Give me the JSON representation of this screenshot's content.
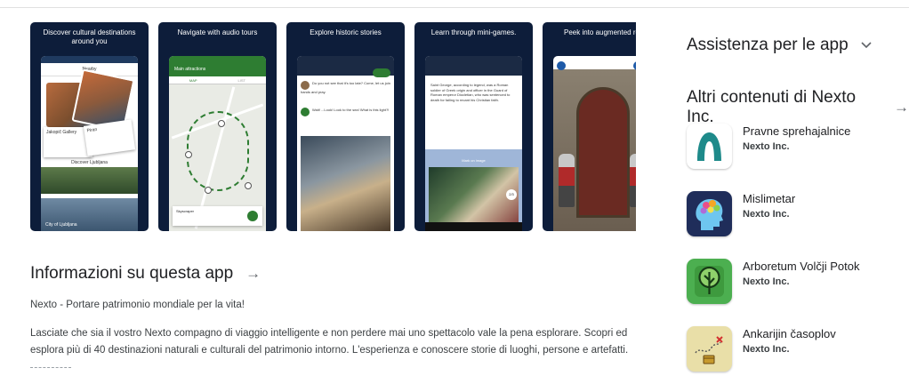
{
  "screenshots": [
    {
      "caption": "Discover cultural destinations around you",
      "app_bar": "Nearby",
      "card_a_title": "Jakopič Gallery",
      "card_b_title": "Piran",
      "sub_label": "Discover Ljubljana",
      "bottom_label": "City of Ljubljana"
    },
    {
      "caption": "Navigate with audio tours",
      "app_bar": "Main attractions",
      "map_tab": "MAP",
      "list_tab": "LIST",
      "player_label": "Skyscraper"
    },
    {
      "caption": "Explore historic stories",
      "chat_1": "Do you not see that it's too late? Come, let us join hands and pray.",
      "chat_2": "Wait! ...Look! Look to the sea! What is this light?!"
    },
    {
      "caption": "Learn through mini-games.",
      "quiz_text": "Saint George, according to legend, was a Roman soldier of Greek origin and officer in the Guard of Roman emperor Diocletian, who was sentenced to death for failing to recant his Christian faith.",
      "hint": "Mark on image",
      "counter": "2/3"
    },
    {
      "caption": "Peek into augmented reality"
    }
  ],
  "about": {
    "title": "Informazioni su questa app",
    "tagline": "Nexto - Portare patrimonio mondiale per la vita!",
    "description": "Lasciate che sia il vostro Nexto compagno di viaggio intelligente e non perdere mai uno spettacolo vale la pena esplorare. Scopri ed esplora più di 40 destinazioni naturali e culturali del patrimonio intorno. L'esperienza e conoscere storie di luoghi, persone e artefatti."
  },
  "sidebar": {
    "help_title": "Assistenza per le app",
    "more_title": "Altri contenuti di Nexto Inc.",
    "apps": [
      {
        "name": "Pravne sprehajalnice",
        "developer": "Nexto Inc.",
        "icon": "pravne-icon",
        "color": "#1e8a8a"
      },
      {
        "name": "Mislimetar",
        "developer": "Nexto Inc.",
        "icon": "mislimetar-icon",
        "color": "#2a3b7a"
      },
      {
        "name": "Arboretum Volčji Potok",
        "developer": "Nexto Inc.",
        "icon": "arboretum-icon",
        "color": "#3e9a3e"
      },
      {
        "name": "Ankarijin časoplov",
        "developer": "Nexto Inc.",
        "icon": "ankarijin-icon",
        "color": "#e3d7a0"
      }
    ]
  },
  "glyphs": {
    "arrow": "→",
    "chevron": "⌄"
  }
}
